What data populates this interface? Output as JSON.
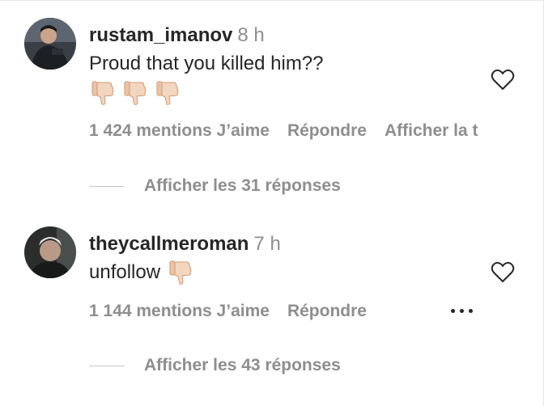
{
  "comments": [
    {
      "username": "rustam_imanov",
      "time": "8 h",
      "text": "Proud that you killed him??",
      "emoji": [
        "thumbs-down-icon",
        "thumbs-down-icon",
        "thumbs-down-icon"
      ],
      "likes": "1 424 mentions J’aime",
      "reply_label": "Répondre",
      "extra_label": "Afficher la t",
      "view_replies": "Afficher les 31 réponses"
    },
    {
      "username": "theycallmeroman",
      "time": "7 h",
      "text": "unfollow",
      "emoji": [
        "thumbs-down-icon"
      ],
      "likes": "1 144 mentions J’aime",
      "reply_label": "Répondre",
      "view_replies": "Afficher les 43 réponses"
    }
  ],
  "colors": {
    "text": "#262626",
    "secondary": "#8e8e8e",
    "thumb_skin": "#f3d6bf"
  }
}
